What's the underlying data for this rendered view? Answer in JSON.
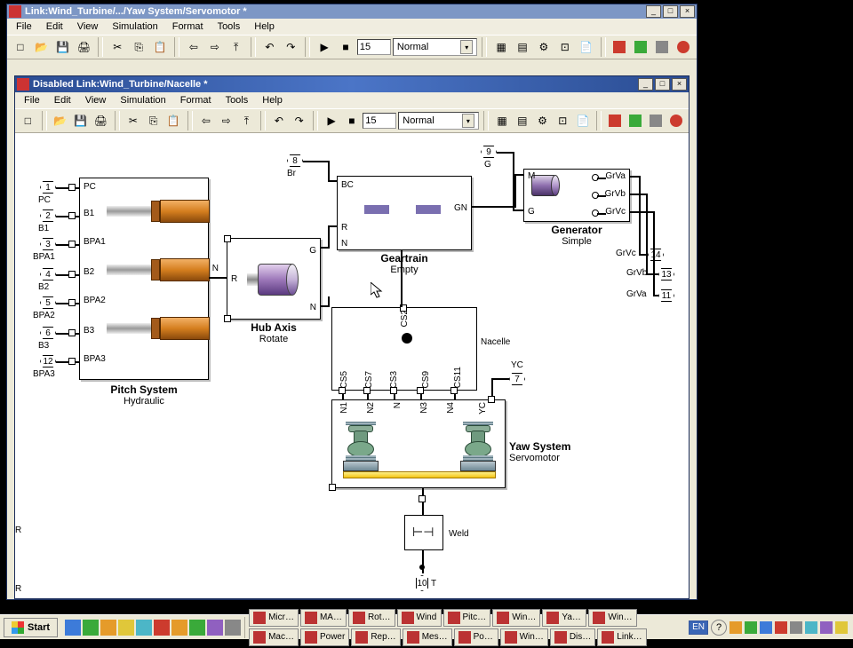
{
  "outer_window": {
    "title": "Link:Wind_Turbine/.../Yaw System/Servomotor *",
    "min": "_",
    "max": "□",
    "close": "×",
    "menu": {
      "file": "File",
      "edit": "Edit",
      "view": "View",
      "sim": "Simulation",
      "format": "Format",
      "tools": "Tools",
      "help": "Help"
    },
    "stop_time": "15",
    "mode": "Normal"
  },
  "inner_window": {
    "title": "Disabled Link:Wind_Turbine/Nacelle *",
    "min": "_",
    "max": "□",
    "close": "×",
    "menu": {
      "file": "File",
      "edit": "Edit",
      "view": "View",
      "sim": "Simulation",
      "format": "Format",
      "tools": "Tools",
      "help": "Help"
    },
    "stop_time": "15",
    "mode": "Normal"
  },
  "canvas": {
    "pitch": {
      "block_title": "Pitch System",
      "block_sub": "Hydraulic",
      "ports": {
        "p1": "1",
        "p1l": "PC",
        "pc": "PC",
        "p2": "2",
        "p2l": "B1",
        "b1": "B1",
        "p3": "3",
        "p3l": "BPA1",
        "bpa1": "BPA1",
        "p4": "4",
        "p4l": "B2",
        "b2": "B2",
        "p5": "5",
        "p5l": "BPA2",
        "bpa2": "BPA2",
        "p6": "6",
        "p6l": "B3",
        "b3": "B3",
        "p12": "12",
        "p12l": "BPA3",
        "bpa3": "BPA3"
      },
      "out": "N"
    },
    "hub": {
      "title": "Hub Axis",
      "sub": "Rotate",
      "R": "R",
      "G": "G",
      "N": "N"
    },
    "gear": {
      "title": "Geartrain",
      "sub": "Empty",
      "BC": "BC",
      "GN": "GN",
      "R": "R",
      "N": "N"
    },
    "br_port_num": "8",
    "br_port_lbl": "Br",
    "gport_num": "9",
    "gport_lbl": "G",
    "generator": {
      "title": "Generator",
      "sub": "Simple",
      "M": "M",
      "G": "G",
      "GrVa": "GrVa",
      "GrVb": "GrVb",
      "GrVc": "GrVc",
      "out11": "11",
      "out11l": "GrVa",
      "out13": "13",
      "out13l": "GrVb",
      "out14": "14",
      "out14l": "GrVc"
    },
    "nacelle_label": "Nacelle",
    "nacelle_cs": {
      "cs2": "CS2",
      "cs3": "CS3",
      "cs5": "CS5",
      "cs7": "CS7",
      "cs9": "CS9",
      "cs11": "CS11"
    },
    "yc_label": "YC",
    "ycport": "7",
    "yaw": {
      "title": "Yaw System",
      "sub": "Servomotor",
      "N": "N",
      "N1": "N1",
      "N2": "N2",
      "N3": "N3",
      "N4": "N4",
      "YC": "YC"
    },
    "weld": {
      "label": "Weld",
      "glyph": "⊢⊣"
    },
    "T_label": "T",
    "Tport": "10",
    "left_R1": "R",
    "left_R2": "R"
  },
  "taskbar": {
    "start": "Start",
    "lang": "EN",
    "tasks": [
      {
        "l": "Micr…"
      },
      {
        "l": "MA…"
      },
      {
        "l": "Rot…"
      },
      {
        "l": "Wind"
      },
      {
        "l": "Pitc…"
      },
      {
        "l": "Win…"
      },
      {
        "l": "Ya…"
      },
      {
        "l": "Win…"
      },
      {
        "l": "Mac…"
      },
      {
        "l": "Power"
      },
      {
        "l": "Rep…"
      },
      {
        "l": "Mes…"
      },
      {
        "l": "Po…"
      },
      {
        "l": "Win…"
      },
      {
        "l": "Dis…"
      },
      {
        "l": "Link…"
      }
    ]
  },
  "toolbar_icons": {
    "new": "□",
    "open": "📂",
    "save": "💾",
    "print": "🖨",
    "cut": "✂",
    "copy": "⎘",
    "paste": "📋",
    "undo": "↶",
    "redo": "↷",
    "back": "⇦",
    "fwd": "⇨",
    "up": "⤒",
    "play": "▶",
    "stop": "■",
    "lib": "▦",
    "scope": "▤",
    "build": "⚙",
    "cfg": "⊡",
    "doc": "📄",
    "link1": "□",
    "link2": "▥",
    "link3": "▧",
    "link4": "⊘"
  }
}
